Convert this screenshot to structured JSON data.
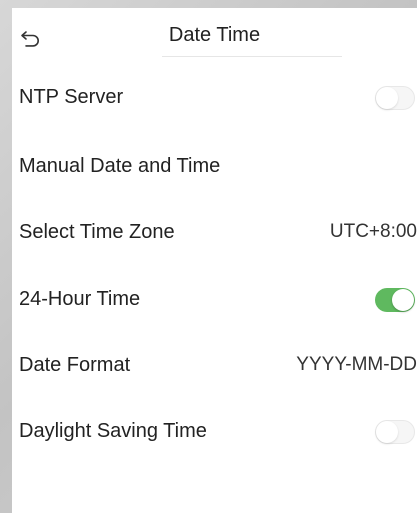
{
  "header": {
    "back_icon": "back-arrow-icon",
    "title": "Date Time"
  },
  "settings": [
    {
      "label": "NTP Server",
      "control": "toggle",
      "on": false
    },
    {
      "label": "Manual Date and Time",
      "control": "none"
    },
    {
      "label": "Select Time Zone",
      "control": "value",
      "value": "UTC+8:00"
    },
    {
      "label": "24-Hour Time",
      "control": "toggle",
      "on": true
    },
    {
      "label": "Date Format",
      "control": "value",
      "value": "YYYY-MM-DD"
    },
    {
      "label": "Daylight Saving Time",
      "control": "toggle",
      "on": false
    }
  ],
  "colors": {
    "toggle_on": "#5fb95f",
    "toggle_off": "#f6f6f6",
    "text": "#222222"
  }
}
